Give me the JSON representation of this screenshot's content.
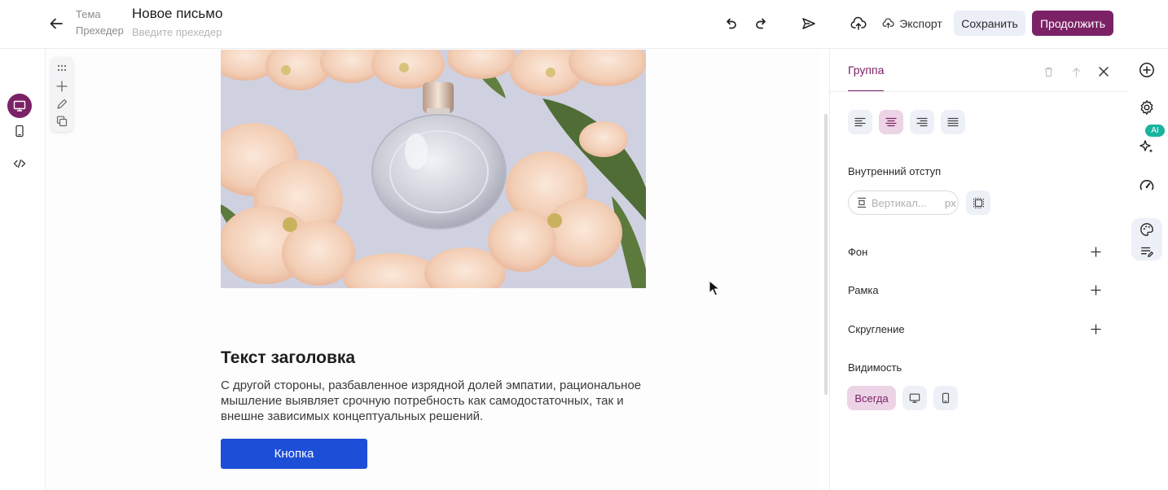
{
  "header": {
    "back_icon": "arrow-left-icon",
    "subject_label": "Тема",
    "preheader_label": "Прехедер",
    "title": "Новое письмо",
    "preheader_placeholder": "Введите прехедер",
    "undo_icon": "undo-icon",
    "redo_icon": "redo-icon",
    "send_icon": "send-icon",
    "upload_icon": "cloud-upload-icon",
    "export_label": "Экспорт",
    "save_label": "Сохранить",
    "continue_label": "Продолжить"
  },
  "left_rail": {
    "items": [
      {
        "icon": "desktop-icon",
        "active": true
      },
      {
        "icon": "mobile-icon",
        "active": false
      },
      {
        "icon": "code-icon",
        "active": false
      }
    ]
  },
  "block_toolbar": {
    "items": [
      "drag-handle-icon",
      "plus-icon",
      "pencil-icon",
      "copy-icon"
    ]
  },
  "canvas": {
    "image_description_icon": "perfume-bottle-photo",
    "heading": "Текст заголовка",
    "paragraph": "С другой стороны, разбавленное изрядной долей эмпатии, рациональное мышление выявляет срочную потребность как самодостаточных, так и внешне зависимых концептуальных решений.",
    "button_label": "Кнопка"
  },
  "panel": {
    "tab_label": "Группа",
    "alignment_options": [
      "align-left",
      "align-center",
      "align-right",
      "align-justify"
    ],
    "alignment_selected": "align-center",
    "padding_label": "Внутренний отступ",
    "padding_placeholder": "Вертикал...",
    "padding_unit": "px",
    "background_label": "Фон",
    "border_label": "Рамка",
    "radius_label": "Скругление",
    "visibility_label": "Видимость",
    "visibility_always": "Всегда",
    "visibility_selected": "always"
  },
  "right_rail": {
    "ai_badge": "AI",
    "items": [
      "add-circle-icon",
      "settings-gear-icon",
      "ai-sparkles-icon",
      "speed-gauge-icon",
      "palette-icon",
      "text-edit-icon"
    ]
  },
  "colors": {
    "brand": "#7b2266",
    "brand_soft": "#ecd4e6",
    "cta_blue": "#1d4ed8",
    "ai_teal": "#19b39e"
  }
}
